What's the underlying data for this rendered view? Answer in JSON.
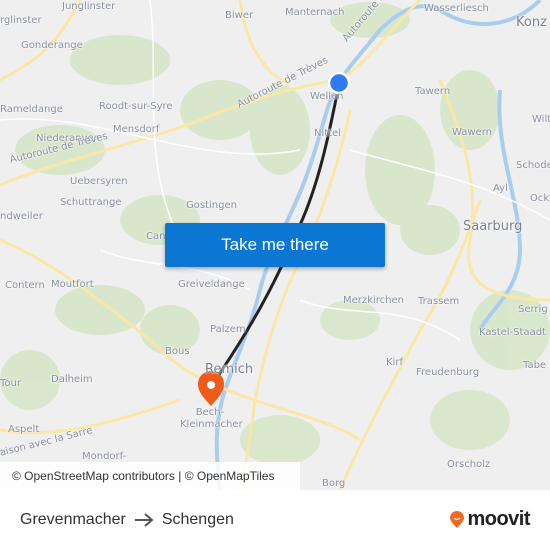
{
  "map": {
    "labels": [
      "Junglinster",
      "rglinster",
      "Gonderange",
      "Biwer",
      "Manternach",
      "Wasserliesch",
      "Konz",
      "Rameldange",
      "Roodt-sur-Syre",
      "Wellen",
      "Tawern",
      "Niederanven",
      "Mensdorf",
      "Nittel",
      "Wawern",
      "Wilt",
      "Uebersyren",
      "Schoden",
      "Schuttrange",
      "Gostingen",
      "Ayl",
      "Ockf",
      "ndweiler",
      "Saarburg",
      "Can",
      "Contern",
      "Moutfort",
      "Greiveldange",
      "Merzkirchen",
      "Trassem",
      "Serrig",
      "Kastel-Staadt",
      "Palzem",
      "Bous",
      "Remich",
      "Kirf",
      "Tabe",
      "Tour",
      "Dalheim",
      "Freudenburg",
      "Bech-Kleinmacher",
      "Aspelt",
      "Mondorf-",
      "Orscholz",
      "Borg"
    ],
    "road_labels": [
      "Autoroute de Trèves",
      "Autoroute de Trèves",
      "Autoroute de",
      "aison avec la Sarre"
    ],
    "origin_color": "#2f7bf0",
    "destination_color": "#f05a1a",
    "route_color": "#222222",
    "origin_icon": "blue-dot-icon",
    "destination_icon": "map-pin-icon"
  },
  "cta": {
    "label": "Take me there",
    "color": "#0c77d2"
  },
  "attribution": "© OpenStreetMap contributors | © OpenMapTiles",
  "footer": {
    "origin": "Grevenmacher",
    "arrow_icon": "arrow-right-icon",
    "destination": "Schengen",
    "brand": "moovit",
    "brand_color": "#f26a21"
  }
}
